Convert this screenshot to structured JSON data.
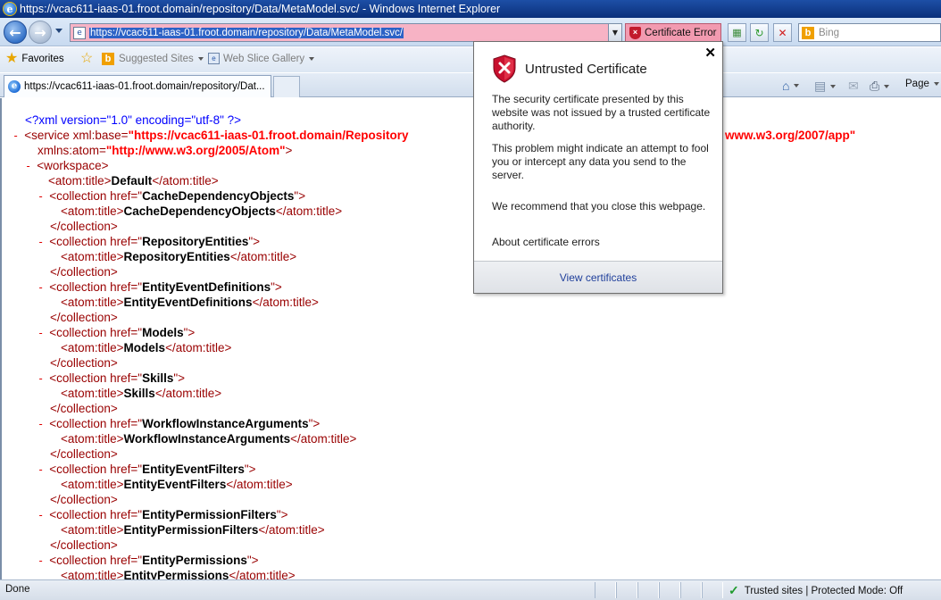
{
  "window": {
    "title": "https://vcac611-iaas-01.froot.domain/repository/Data/MetaModel.svc/ - Windows Internet Explorer"
  },
  "navbar": {
    "address_url": "https://vcac611-iaas-01.froot.domain/repository/Data/MetaModel.svc/",
    "cert_error_label": "Certificate Error",
    "search_placeholder": "Bing"
  },
  "favorites_bar": {
    "favorites_label": "Favorites",
    "suggested_sites_label": "Suggested Sites",
    "web_slice_gallery_label": "Web Slice Gallery"
  },
  "tabs": [
    {
      "label": "https://vcac611-iaas-01.froot.domain/repository/Dat..."
    }
  ],
  "command_bar": {
    "page_label": "Page"
  },
  "xml": {
    "declaration": "<?xml version=\"1.0\" encoding=\"utf-8\" ?>",
    "service_open": "<service",
    "service_base_attr": "xml:base=",
    "service_base_val": "\"https://vcac611-iaas-01.froot.domain/Repository",
    "service_app_val": "www.w3.org/2007/app\"",
    "xmlns_atom_attr": "xmlns:atom=",
    "xmlns_atom_val": "\"http://www.w3.org/2005/Atom\"",
    "xmlns_atom_close": ">",
    "workspace_open": "<workspace>",
    "default_title_open": "<atom:title>",
    "default_title_text": "Default",
    "default_title_close": "</atom:title>",
    "collections": [
      {
        "href": "CacheDependencyObjects",
        "title": "CacheDependencyObjects"
      },
      {
        "href": "RepositoryEntities",
        "title": "RepositoryEntities"
      },
      {
        "href": "EntityEventDefinitions",
        "title": "EntityEventDefinitions"
      },
      {
        "href": "Models",
        "title": "Models"
      },
      {
        "href": "Skills",
        "title": "Skills"
      },
      {
        "href": "WorkflowInstanceArguments",
        "title": "WorkflowInstanceArguments"
      },
      {
        "href": "EntityEventFilters",
        "title": "EntityEventFilters"
      },
      {
        "href": "EntityPermissionFilters",
        "title": "EntityPermissionFilters"
      },
      {
        "href": "EntityPermissions",
        "title": "EntityPermissions"
      }
    ],
    "collection_open_prefix": "<collection href=",
    "collection_close": "</collection>",
    "title_open": "<atom:title>",
    "title_close": "</atom:title>"
  },
  "cert_popup": {
    "title": "Untrusted Certificate",
    "close_glyph": "✕",
    "para1": "The security certificate presented by this website was not issued by a trusted certificate authority.",
    "para2": "This problem might indicate an attempt to fool you or intercept any data you send to the server.",
    "para3": "We recommend that you close this webpage.",
    "about_link": "About certificate errors",
    "view_certs_link": "View certificates"
  },
  "status_bar": {
    "left_text": "Done",
    "zone_text": "Trusted sites | Protected Mode: Off"
  },
  "colors": {
    "address_bg_error": "#f7b3c5",
    "cert_error_bg": "#f29ab0",
    "xml_tag": "#990000",
    "xml_minus": "#e00000",
    "xml_pi": "#0000ff",
    "popup_link": "#1f3f9b"
  }
}
